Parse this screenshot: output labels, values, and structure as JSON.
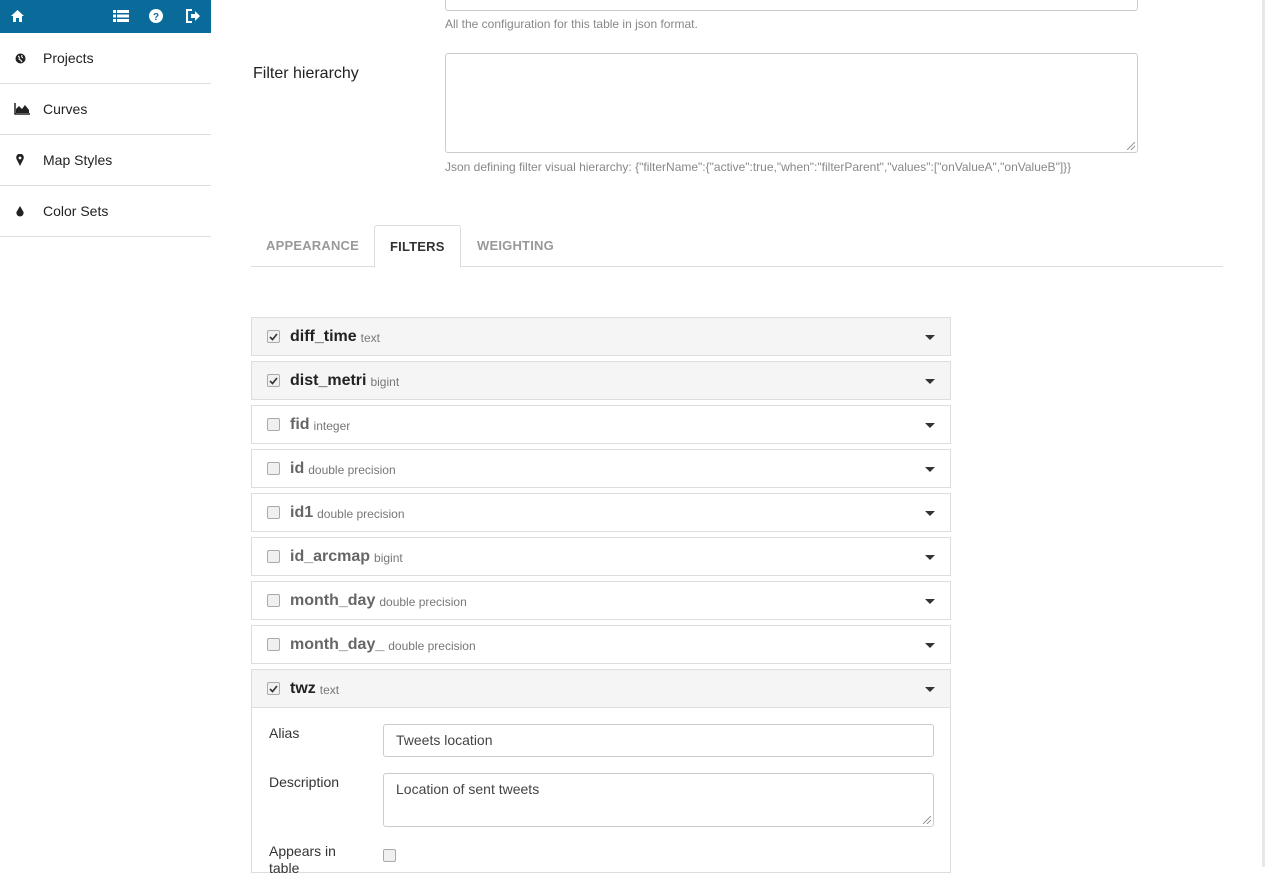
{
  "topbar": {
    "icons": [
      "home-icon",
      "list-icon",
      "help-icon",
      "logout-icon"
    ],
    "color": "#0a6a99"
  },
  "sidebar": {
    "items": [
      {
        "label": "Projects",
        "icon": "globe-icon"
      },
      {
        "label": "Curves",
        "icon": "area-chart-icon"
      },
      {
        "label": "Map Styles",
        "icon": "map-marker-icon"
      },
      {
        "label": "Color Sets",
        "icon": "tint-icon"
      }
    ]
  },
  "config": {
    "help": "All the configuration for this table in json format."
  },
  "filter_hierarchy": {
    "label": "Filter hierarchy",
    "value": "",
    "help": "Json defining filter visual hierarchy: {\"filterName\":{\"active\":true,\"when\":\"filterParent\",\"values\":[\"onValueA\",\"onValueB\"]}}"
  },
  "tabs": [
    {
      "label": "APPEARANCE",
      "active": false
    },
    {
      "label": "FILTERS",
      "active": true
    },
    {
      "label": "WEIGHTING",
      "active": false
    }
  ],
  "filters": [
    {
      "name": "diff_time",
      "type": "text",
      "checked": true
    },
    {
      "name": "dist_metri",
      "type": "bigint",
      "checked": true
    },
    {
      "name": "fid",
      "type": "integer",
      "checked": false
    },
    {
      "name": "id",
      "type": "double precision",
      "checked": false
    },
    {
      "name": "id1",
      "type": "double precision",
      "checked": false
    },
    {
      "name": "id_arcmap",
      "type": "bigint",
      "checked": false
    },
    {
      "name": "month_day",
      "type": "double precision",
      "checked": false
    },
    {
      "name": "month_day_",
      "type": "double precision",
      "checked": false
    },
    {
      "name": "twz",
      "type": "text",
      "checked": true
    }
  ],
  "expanded_filter": {
    "alias_label": "Alias",
    "alias_value": "Tweets location",
    "description_label": "Description",
    "description_value": "Location of sent tweets",
    "appears_label": "Appears in",
    "appears_label_2": "table"
  }
}
